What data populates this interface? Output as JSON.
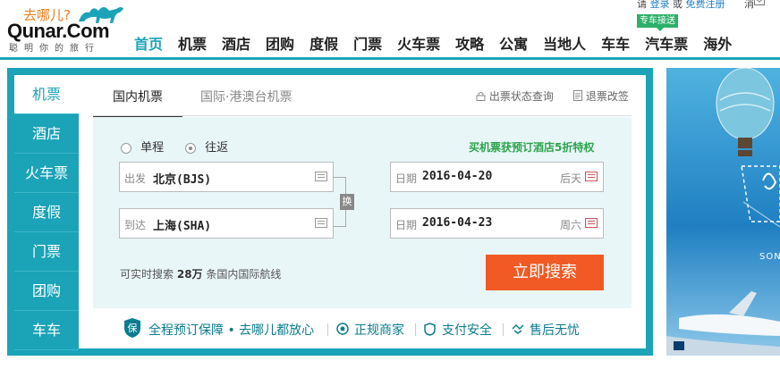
{
  "header": {
    "logo_top": "去哪儿?",
    "logo_main": "Qunar.Com",
    "logo_sub": "聪明你的旅行",
    "top_links": {
      "prefix": "请",
      "login": "登录",
      "or": "或",
      "register": "免费注册",
      "message": "消"
    },
    "nav": [
      "首页",
      "机票",
      "酒店",
      "团购",
      "度假",
      "门票",
      "火车票",
      "攻略",
      "公寓",
      "当地人",
      "车车",
      "汽车票",
      "海外"
    ],
    "nav_active": "首页",
    "badge": "专车接送"
  },
  "sidebar": {
    "items": [
      "机票",
      "酒店",
      "火车票",
      "度假",
      "门票",
      "团购",
      "车车"
    ],
    "active": "机票"
  },
  "tabs": {
    "domestic": "国内机票",
    "international": "国际·港澳台机票"
  },
  "tools": {
    "flight_status": "出票状态查询",
    "refund": "退票改签"
  },
  "trip_type": {
    "one_way": "单程",
    "round_trip": "往返",
    "selected": "往返"
  },
  "promo": "买机票获预订酒店5折特权",
  "form": {
    "from_label": "出发",
    "from_value": "北京(BJS)",
    "to_label": "到达",
    "to_value": "上海(SHA)",
    "swap": "换",
    "depart_label": "日期",
    "depart_value": "2016-04-20",
    "depart_weekday": "后天",
    "return_label": "日期",
    "return_value": "2016-04-23",
    "return_weekday": "周六"
  },
  "search_info": {
    "prefix": "可实时搜索",
    "count": "28万",
    "suffix": "条国内国际航线"
  },
  "search_button": "立即搜索",
  "guarantees": [
    "全程预订保障 • 去哪儿都放心",
    "正规商家",
    "支付安全",
    "售后无忧"
  ],
  "banner": {
    "text": "SON"
  },
  "colors": {
    "brand": "#1ba3b8",
    "search": "#f15a24",
    "promo": "#2aa44a"
  }
}
